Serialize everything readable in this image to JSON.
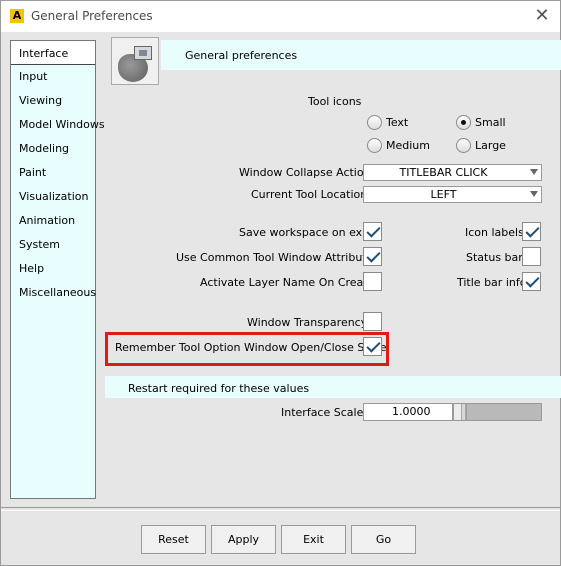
{
  "window": {
    "title": "General Preferences"
  },
  "icons": {
    "app": "app-logo-icon",
    "close": "close-icon",
    "header": "preferences-icon"
  },
  "sidebar": {
    "items": [
      {
        "label": "Interface",
        "active": true
      },
      {
        "label": "Input"
      },
      {
        "label": "Viewing"
      },
      {
        "label": "Model Windows"
      },
      {
        "label": "Modeling"
      },
      {
        "label": "Paint"
      },
      {
        "label": "Visualization"
      },
      {
        "label": "Animation"
      },
      {
        "label": "System"
      },
      {
        "label": "Help"
      },
      {
        "label": "Miscellaneous"
      }
    ]
  },
  "header": {
    "title": "General preferences"
  },
  "tool_icons": {
    "label": "Tool icons",
    "options": [
      {
        "label": "Text",
        "selected": false
      },
      {
        "label": "Small",
        "selected": true
      },
      {
        "label": "Medium",
        "selected": false
      },
      {
        "label": "Large",
        "selected": false
      }
    ]
  },
  "window_collapse": {
    "label": "Window Collapse Action",
    "value": "TITLEBAR CLICK"
  },
  "tool_location": {
    "label": "Current Tool Location",
    "value": "LEFT"
  },
  "checks_left": [
    {
      "label": "Save workspace on exit",
      "checked": true
    },
    {
      "label": "Use Common Tool Window Attributes",
      "checked": true
    },
    {
      "label": "Activate Layer Name On Create",
      "checked": false
    }
  ],
  "checks_right": [
    {
      "label": "Icon labels",
      "checked": true
    },
    {
      "label": "Status bar",
      "checked": false
    },
    {
      "label": "Title bar info",
      "checked": true
    }
  ],
  "transparency": {
    "label": "Window Transparency",
    "checked": false
  },
  "remember": {
    "label": "Remember Tool Option Window Open/Close State",
    "checked": true
  },
  "restart": {
    "label": "Restart required for these values"
  },
  "interface_scale": {
    "label": "Interface Scale",
    "value": "1.0000",
    "slider_fraction": 0.0
  },
  "buttons": {
    "reset": "Reset",
    "apply": "Apply",
    "exit": "Exit",
    "go": "Go"
  }
}
